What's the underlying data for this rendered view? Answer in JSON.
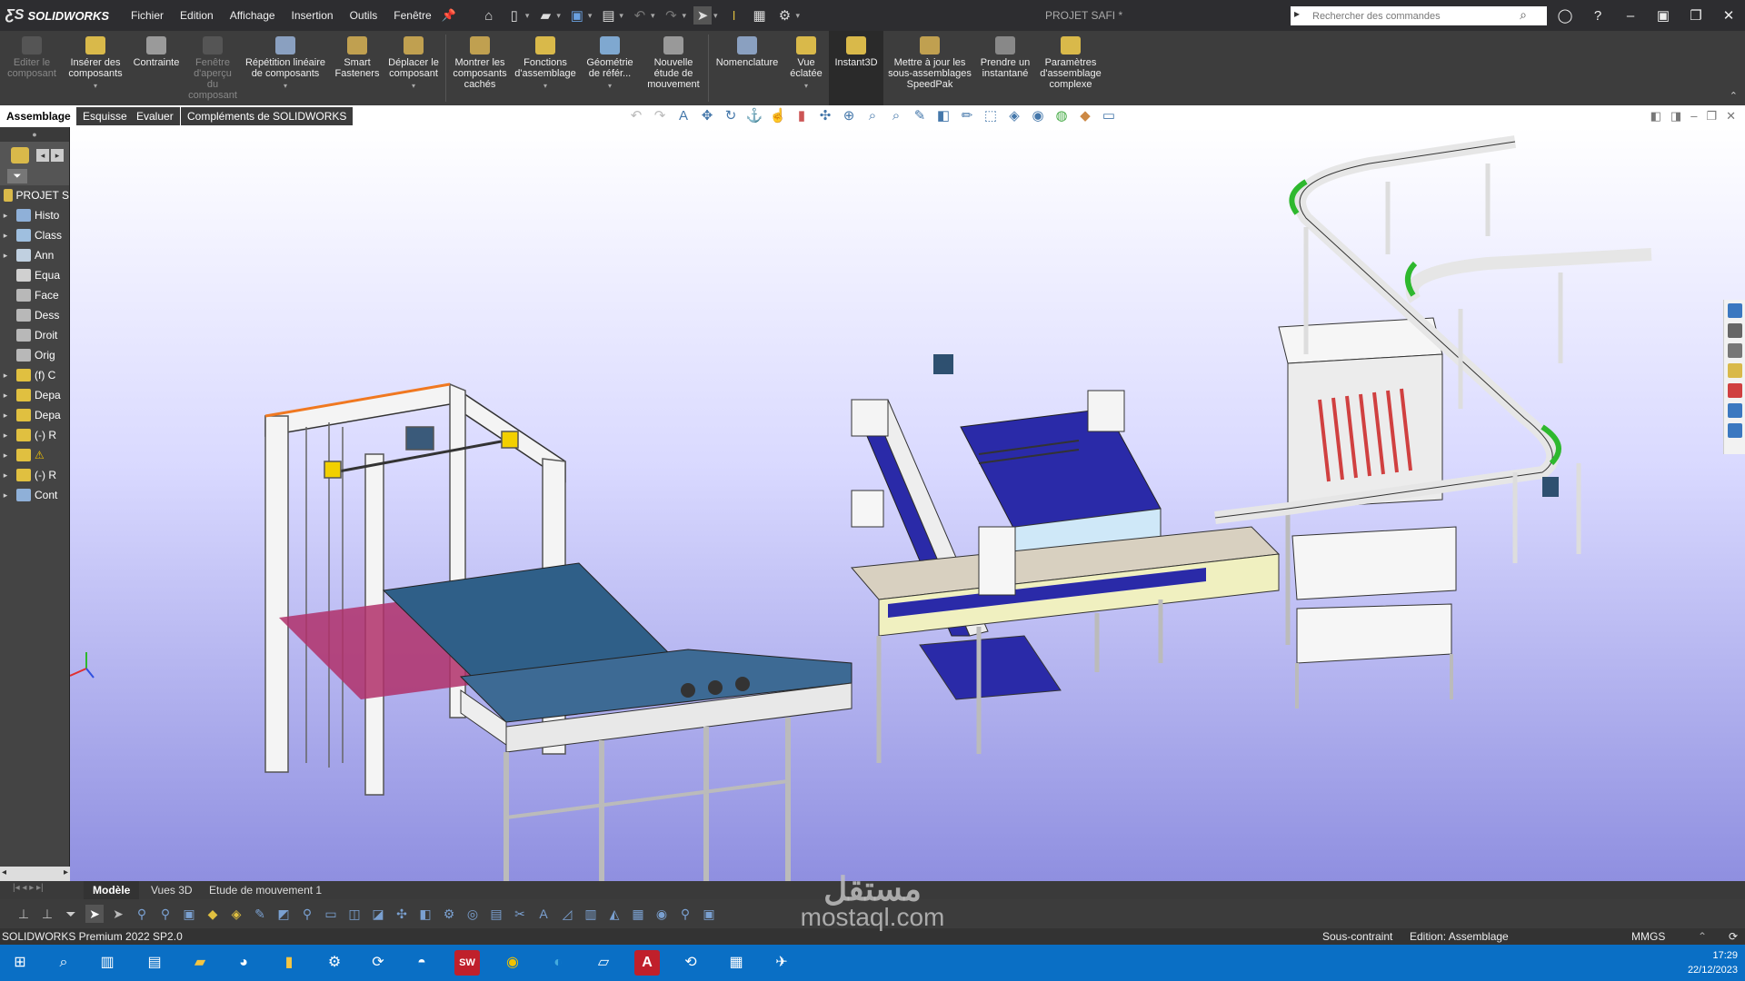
{
  "app": {
    "name": "SOLIDWORKS",
    "document_title": "PROJET SAFI *"
  },
  "menu": [
    "Fichier",
    "Edition",
    "Affichage",
    "Insertion",
    "Outils",
    "Fenêtre"
  ],
  "search": {
    "placeholder": "Rechercher des commandes"
  },
  "ribbon": [
    {
      "label": "Editer le composant",
      "disabled": true
    },
    {
      "label": "Insérer des composants",
      "disabled": false
    },
    {
      "label": "Contrainte",
      "disabled": false
    },
    {
      "label": "Fenêtre d'aperçu du composant",
      "disabled": true
    },
    {
      "label": "Répétition linéaire de composants",
      "disabled": false
    },
    {
      "label": "Smart Fasteners",
      "disabled": false
    },
    {
      "label": "Déplacer le composant",
      "disabled": false
    },
    {
      "label": "Montrer les composants cachés",
      "disabled": false
    },
    {
      "label": "Fonctions d'assemblage",
      "disabled": false
    },
    {
      "label": "Géométrie de référ...",
      "disabled": false
    },
    {
      "label": "Nouvelle étude de mouvement",
      "disabled": false
    },
    {
      "label": "Nomenclature",
      "disabled": false
    },
    {
      "label": "Vue éclatée",
      "disabled": false
    },
    {
      "label": "Instant3D",
      "disabled": false,
      "selected": true
    },
    {
      "label": "Mettre à jour les sous-assemblages SpeedPak",
      "disabled": false
    },
    {
      "label": "Prendre un instantané",
      "disabled": false
    },
    {
      "label": "Paramètres d'assemblage complexe",
      "disabled": false
    }
  ],
  "command_tabs": [
    "Assemblage",
    "Esquisse",
    "Evaluer",
    "Compléments de SOLIDWORKS"
  ],
  "feature_tree": {
    "root": "PROJET S",
    "items": [
      {
        "label": "Histo",
        "color": "#8fb0d8"
      },
      {
        "label": "Class",
        "color": "#9fbfdf"
      },
      {
        "label": "Ann",
        "color": "#c0d0e0"
      },
      {
        "label": "Equa",
        "color": "#d0d0d0"
      },
      {
        "label": "Face",
        "color": "#b8b8b8"
      },
      {
        "label": "Dess",
        "color": "#b8b8b8"
      },
      {
        "label": "Droit",
        "color": "#b8b8b8"
      },
      {
        "label": "Orig",
        "color": "#b8b8b8"
      },
      {
        "label": "(f) C",
        "color": "#e0c040"
      },
      {
        "label": "Depa",
        "color": "#e0c040"
      },
      {
        "label": "Depa",
        "color": "#e0c040"
      },
      {
        "label": "(-) R",
        "color": "#e0c040"
      },
      {
        "label": "",
        "color": "#e0c040",
        "warning": true
      },
      {
        "label": "(-) R",
        "color": "#e0c040"
      },
      {
        "label": "Cont",
        "color": "#8fb0d8"
      }
    ]
  },
  "bottom_tabs": [
    "Modèle",
    "Vues 3D",
    "Etude de mouvement 1"
  ],
  "status": {
    "product": "SOLIDWORKS Premium 2022 SP2.0",
    "state": "Sous-contraint",
    "editing": "Edition: Assemblage",
    "units": "MMGS"
  },
  "clock": {
    "time": "17:29",
    "date": "22/12/2023"
  },
  "watermark": {
    "text": "مستقل",
    "site": "mostaql.com"
  },
  "colors": {
    "ribbon_bg": "#3d3d3d",
    "taskbar": "#0a6fc5",
    "frame": "#f4f4f4",
    "belt_blue": "#2a2aa8",
    "accent_orange": "#f07820"
  }
}
